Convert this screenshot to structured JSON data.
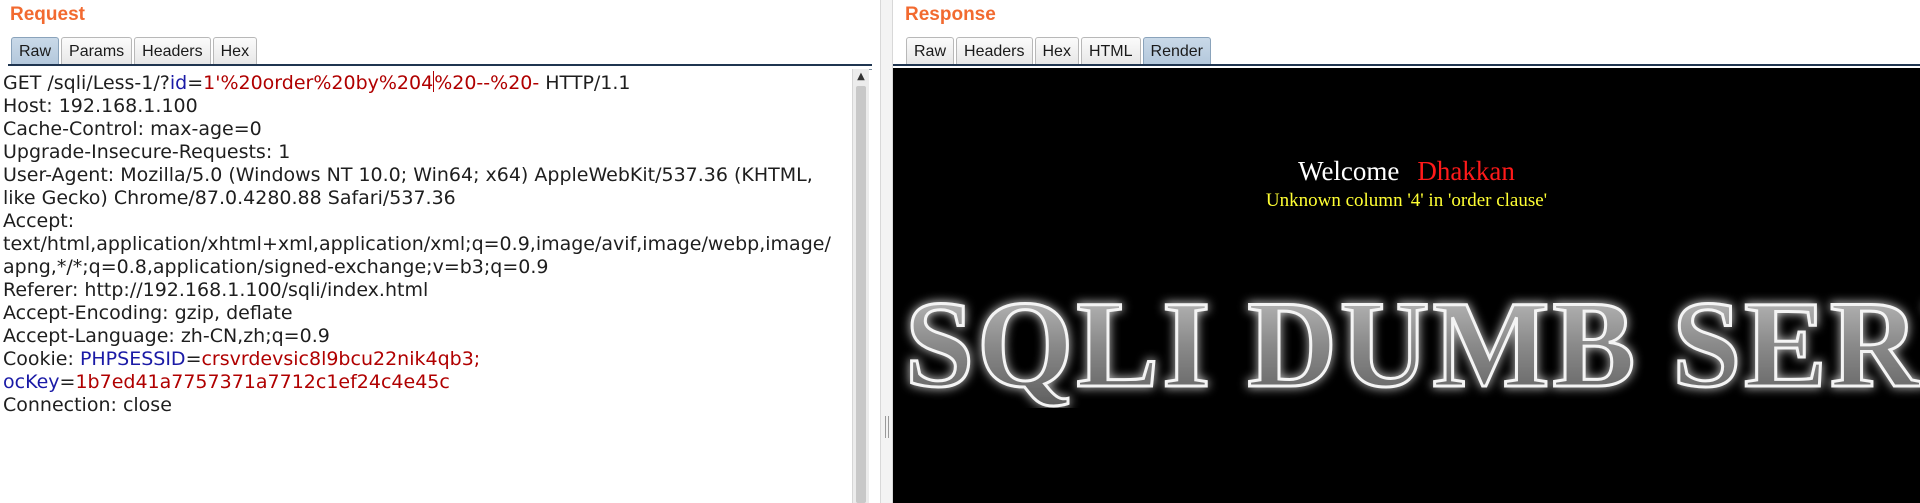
{
  "request": {
    "title": "Request",
    "tabs": [
      "Raw",
      "Params",
      "Headers",
      "Hex"
    ],
    "active_tab": "Raw",
    "line1": {
      "prefix": "GET /sqli/Less-1/?",
      "param_name": "id",
      "eq": "=",
      "value_before_caret": "1'%20order%20by%204",
      "value_after_caret": "%20--%20-",
      "suffix": " HTTP/1.1"
    },
    "host": "Host: 192.168.1.100",
    "cache_control": "Cache-Control: max-age=0",
    "upgrade": "Upgrade-Insecure-Requests: 1",
    "user_agent_1": "User-Agent: Mozilla/5.0 (Windows NT 10.0; Win64; x64) AppleWebKit/537.36 (KHTML,",
    "user_agent_2": "like Gecko) Chrome/87.0.4280.88 Safari/537.36",
    "accept_label": "Accept:",
    "accept_1": "text/html,application/xhtml+xml,application/xml;q=0.9,image/avif,image/webp,image/",
    "accept_2": "apng,*/*;q=0.8,application/signed-exchange;v=b3;q=0.9",
    "referer": "Referer: http://192.168.1.100/sqli/index.html",
    "accept_encoding": "Accept-Encoding: gzip, deflate",
    "accept_language": "Accept-Language: zh-CN,zh;q=0.9",
    "cookie": {
      "label": "Cookie: ",
      "name1": "PHPSESSID",
      "eq": "=",
      "value1": "crsvrdevsic8l9bcu22nik4qb3;",
      "name2": "ocKey",
      "value2": "1b7ed41a7757371a7712c1ef24c4e45c"
    },
    "connection": "Connection: close"
  },
  "response": {
    "title": "Response",
    "tabs": [
      "Raw",
      "Headers",
      "Hex",
      "HTML",
      "Render"
    ],
    "active_tab": "Render",
    "welcome": "Welcome",
    "user_name": "Dhakkan",
    "error_message": "Unknown column '4' in 'order clause'",
    "banner_text": "SQLI DUMB SERIES"
  },
  "colors": {
    "title": "#f26a30",
    "param_key": "#1a1aa6",
    "param_value": "#b00000",
    "error_text": "#ffff33",
    "name_text": "#ff1a1a"
  }
}
